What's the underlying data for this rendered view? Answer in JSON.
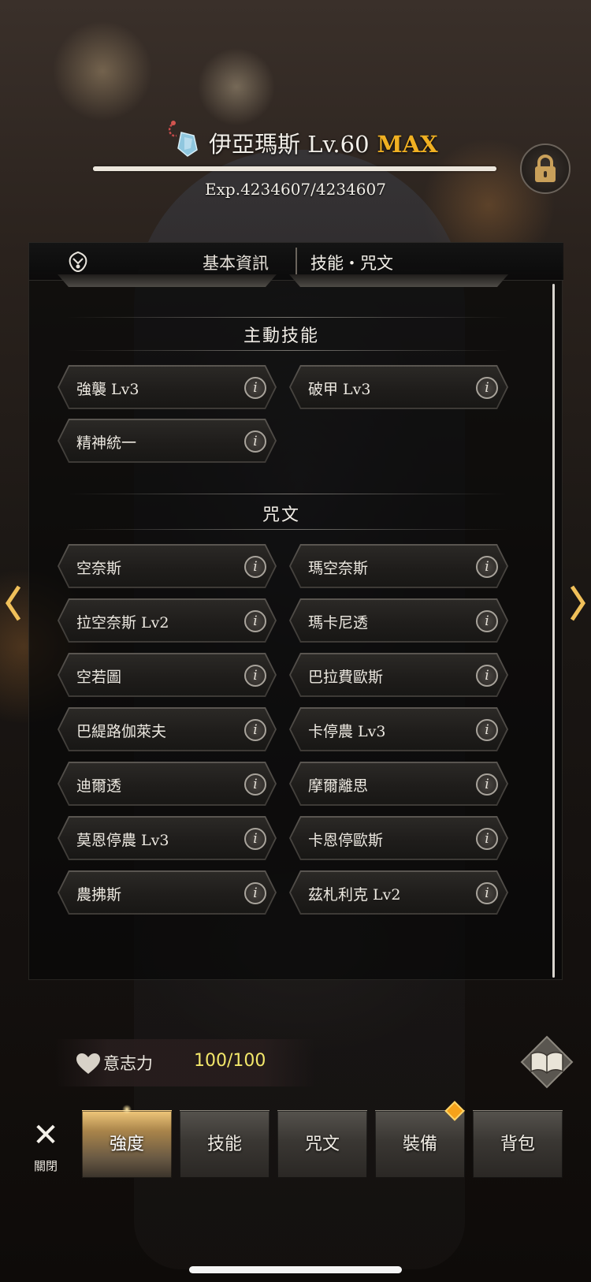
{
  "hero": {
    "name": "伊亞瑪斯 Lv.60",
    "max_badge": "MAX",
    "exp_text": "Exp.4234607/4234607",
    "exp_fraction": 1.0
  },
  "tabs": {
    "basic_info": "基本資訊",
    "skills_spells": "技能・咒文"
  },
  "sections": {
    "active_skills_title": "主動技能",
    "spells_title": "咒文"
  },
  "active_skills": [
    {
      "label": "強襲 Lv3"
    },
    {
      "label": "破甲 Lv3"
    },
    {
      "label": "精神統一"
    }
  ],
  "spells": [
    {
      "label": "空奈斯"
    },
    {
      "label": "瑪空奈斯"
    },
    {
      "label": "拉空奈斯 Lv2"
    },
    {
      "label": "瑪卡尼透"
    },
    {
      "label": "空若圖"
    },
    {
      "label": "巴拉費歐斯"
    },
    {
      "label": "巴緹路伽萊夫"
    },
    {
      "label": "卡停農 Lv3"
    },
    {
      "label": "迪爾透"
    },
    {
      "label": "摩爾離思"
    },
    {
      "label": "莫恩停農 Lv3"
    },
    {
      "label": "卡恩停歐斯"
    },
    {
      "label": "農拂斯"
    },
    {
      "label": "茲札利克 Lv2"
    }
  ],
  "info_glyph": "i",
  "willpower": {
    "label": "意志力",
    "value": "100/100"
  },
  "close": {
    "label": "關閉"
  },
  "nav": [
    {
      "label": "強度",
      "active": true
    },
    {
      "label": "技能",
      "active": false
    },
    {
      "label": "咒文",
      "active": false
    },
    {
      "label": "裝備",
      "active": false
    },
    {
      "label": "背包",
      "active": false
    }
  ],
  "colors": {
    "max": "#f0b022",
    "willpower_value": "#f3e76a",
    "badge": "#f5a21a"
  },
  "icons": {
    "hero": "crystal-pendant-icon",
    "lock": "lock-icon",
    "crest": "guild-crest-icon",
    "info": "info-icon",
    "heart": "heart-icon",
    "book": "book-icon",
    "close": "close-x-icon"
  }
}
